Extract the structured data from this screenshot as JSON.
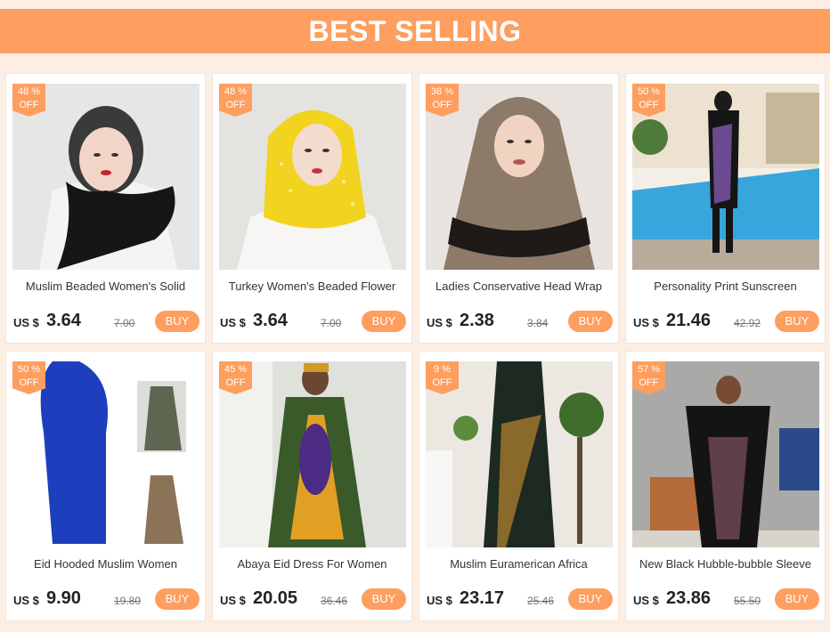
{
  "banner": {
    "title": "BEST SELLING"
  },
  "products": [
    {
      "discount": "48 %",
      "off": "OFF",
      "name": "Muslim Beaded Women's Solid",
      "currency": "US $",
      "price": "3.64",
      "old_price": "7.00",
      "buy": "BUY"
    },
    {
      "discount": "48 %",
      "off": "OFF",
      "name": "Turkey Women's Beaded Flower",
      "currency": "US $",
      "price": "3.64",
      "old_price": "7.00",
      "buy": "BUY"
    },
    {
      "discount": "38 %",
      "off": "OFF",
      "name": "Ladies Conservative Head Wrap",
      "currency": "US $",
      "price": "2.38",
      "old_price": "3.84",
      "buy": "BUY"
    },
    {
      "discount": "50 %",
      "off": "OFF",
      "name": "Personality Print Sunscreen",
      "currency": "US $",
      "price": "21.46",
      "old_price": "42.92",
      "buy": "BUY"
    },
    {
      "discount": "50 %",
      "off": "OFF",
      "name": "Eid Hooded Muslim Women",
      "currency": "US $",
      "price": "9.90",
      "old_price": "19.80",
      "buy": "BUY"
    },
    {
      "discount": "45 %",
      "off": "OFF",
      "name": "Abaya Eid Dress For Women",
      "currency": "US $",
      "price": "20.05",
      "old_price": "36.46",
      "buy": "BUY"
    },
    {
      "discount": "9  %",
      "off": "OFF",
      "name": "Muslim Euramerican Africa",
      "currency": "US $",
      "price": "23.17",
      "old_price": "25.46",
      "buy": "BUY"
    },
    {
      "discount": "57 %",
      "off": "OFF",
      "name": "New Black Hubble-bubble Sleeve",
      "currency": "US $",
      "price": "23.86",
      "old_price": "55.50",
      "buy": "BUY"
    }
  ],
  "colors": {
    "accent": "#fe9e5f",
    "background": "#fdeee3"
  }
}
